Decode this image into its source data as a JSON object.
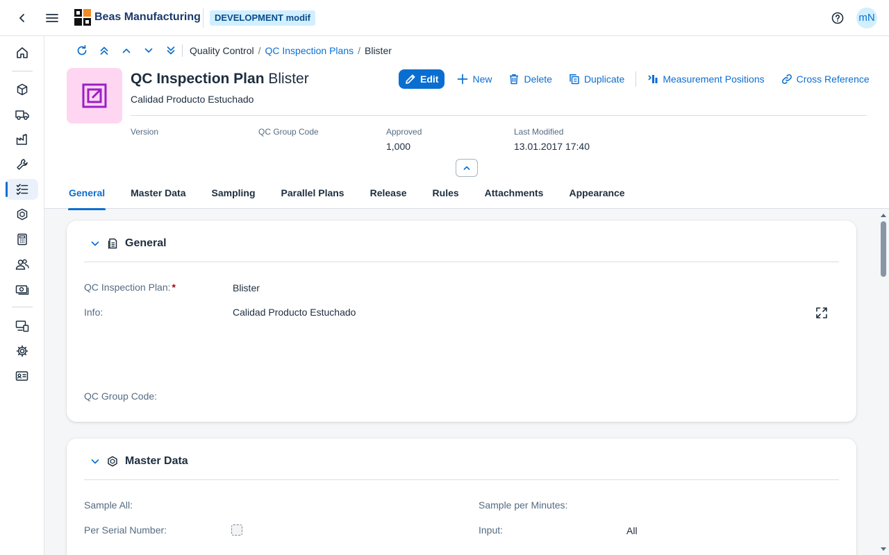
{
  "shell": {
    "app_name": "Beas Manufacturing",
    "environment": "DEVELOPMENT modif",
    "avatar_initials": "mN",
    "icons": [
      "back-icon",
      "menu-icon",
      "help-icon"
    ]
  },
  "sidenav": {
    "items": [
      "home-icon",
      "cube-icon",
      "truck-icon",
      "factory-icon",
      "wrench-icon",
      "checklist-icon",
      "hexagon-icon",
      "calculator-icon",
      "people-icon",
      "money-icon",
      "devices-icon",
      "gear-icon",
      "id-card-icon"
    ],
    "active_item": "checklist-icon"
  },
  "breadcrumb": {
    "items": [
      "Quality Control",
      "QC Inspection Plans",
      "Blister"
    ]
  },
  "object": {
    "type_label": "QC Inspection Plan",
    "name": "Blister",
    "subtitle": "Calidad Producto Estuchado"
  },
  "actions": {
    "edit": "Edit",
    "new": "New",
    "delete": "Delete",
    "duplicate": "Duplicate",
    "measurement_positions": "Measurement Positions",
    "cross_reference": "Cross Reference"
  },
  "attributes": {
    "version_label": "Version",
    "version_value": "",
    "qc_group_label": "QC Group Code",
    "qc_group_value": "",
    "approved_label": "Approved",
    "approved_value": "1,000",
    "modified_label": "Last Modified",
    "modified_value": "13.01.2017 17:40"
  },
  "tabs": [
    "General",
    "Master Data",
    "Sampling",
    "Parallel Plans",
    "Release",
    "Rules",
    "Attachments",
    "Appearance"
  ],
  "general_section": {
    "title": "General",
    "plan_label": "QC Inspection Plan:",
    "plan_required": "*",
    "plan_value": "Blister",
    "info_label": "Info:",
    "info_value": "Calidad Producto Estuchado",
    "group_label": "QC Group Code:",
    "group_value": ""
  },
  "master_data_section": {
    "title": "Master Data",
    "sample_all_label": "Sample All:",
    "sample_all_value": "",
    "per_serial_label": "Per Serial Number:",
    "sample_minutes_label": "Sample per Minutes:",
    "sample_minutes_value": "",
    "input_label": "Input:",
    "input_value": "All"
  },
  "colors": {
    "accent": "#0a6ed1",
    "object_icon_bg": "#ffd6f2",
    "object_icon_fg": "#9b1fc4"
  }
}
